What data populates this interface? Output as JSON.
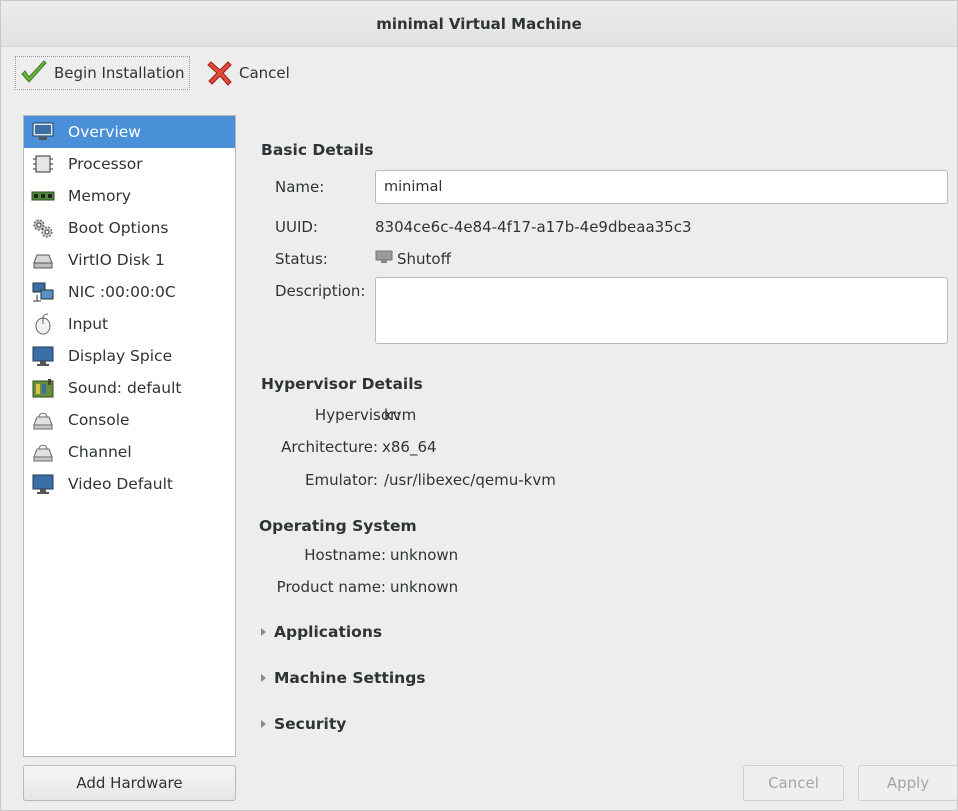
{
  "window": {
    "title": "minimal Virtual Machine"
  },
  "toolbar": {
    "begin_label": "Begin Installation",
    "cancel_label": "Cancel"
  },
  "sidebar": {
    "items": [
      {
        "label": "Overview",
        "icon": "monitor-icon",
        "selected": true
      },
      {
        "label": "Processor",
        "icon": "chip-icon"
      },
      {
        "label": "Memory",
        "icon": "ram-icon"
      },
      {
        "label": "Boot Options",
        "icon": "gears-icon"
      },
      {
        "label": "VirtIO Disk 1",
        "icon": "disk-icon"
      },
      {
        "label": "NIC :00:00:0C",
        "icon": "network-icon"
      },
      {
        "label": "Input",
        "icon": "mouse-icon"
      },
      {
        "label": "Display Spice",
        "icon": "display-icon"
      },
      {
        "label": "Sound: default",
        "icon": "sound-icon"
      },
      {
        "label": "Console",
        "icon": "serial-icon"
      },
      {
        "label": "Channel",
        "icon": "serial-icon"
      },
      {
        "label": "Video Default",
        "icon": "display-icon"
      }
    ]
  },
  "add_hardware_label": "Add Hardware",
  "basic": {
    "title": "Basic Details",
    "name_label": "Name:",
    "name_value": "minimal",
    "uuid_label": "UUID:",
    "uuid_value": "8304ce6c-4e84-4f17-a17b-4e9dbeaa35c3",
    "status_label": "Status:",
    "status_value": "Shutoff",
    "description_label": "Description:",
    "description_value": ""
  },
  "hypervisor": {
    "title": "Hypervisor Details",
    "hypervisor_label": "Hypervisor:",
    "hypervisor_value": "kvm",
    "arch_label": "Architecture:",
    "arch_value": "x86_64",
    "emulator_label": "Emulator:",
    "emulator_value": "/usr/libexec/qemu-kvm"
  },
  "os": {
    "title": "Operating System",
    "hostname_label": "Hostname:",
    "hostname_value": "unknown",
    "product_label": "Product name:",
    "product_value": "unknown"
  },
  "expanders": {
    "applications": "Applications",
    "machine_settings": "Machine Settings",
    "security": "Security"
  },
  "footer": {
    "cancel_label": "Cancel",
    "apply_label": "Apply"
  },
  "colors": {
    "selection": "#4a90d9",
    "window_bg": "#ededed"
  }
}
